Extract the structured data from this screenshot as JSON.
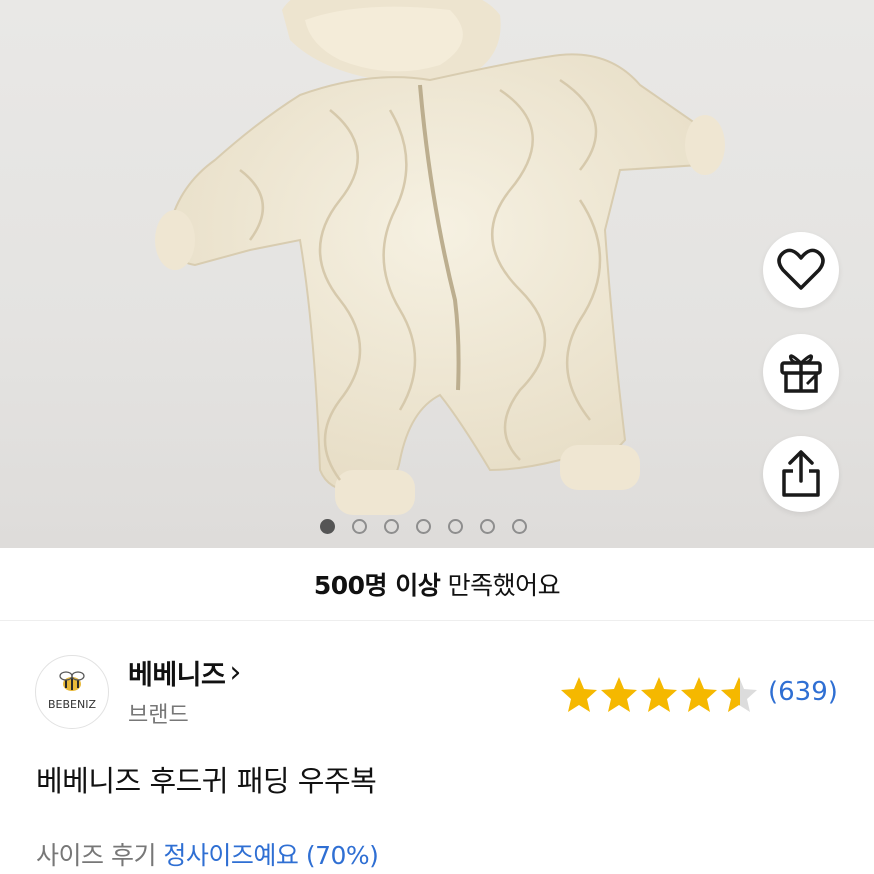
{
  "gallery": {
    "image_alt": "quilted cream hooded padded baby romper",
    "dot_count": 7,
    "active_index": 0
  },
  "actions": {
    "like_icon": "heart-icon",
    "gift_icon": "gift-icon",
    "share_icon": "share-icon"
  },
  "satisfaction": {
    "bold": "500명 이상",
    "rest": " 만족했어요"
  },
  "brand": {
    "logo_text": "BEBENIZ",
    "name": "베베니즈",
    "arrow": "›",
    "type": "브랜드"
  },
  "rating": {
    "stars": 4.6,
    "count": "(639)"
  },
  "product": {
    "name": "베베니즈 후드귀 패딩 우주복"
  },
  "size_review": {
    "label": "사이즈 후기 ",
    "value": "정사이즈예요 (70%)"
  },
  "colors": {
    "accent": "#2f6fd3",
    "star": "#f5b800"
  }
}
